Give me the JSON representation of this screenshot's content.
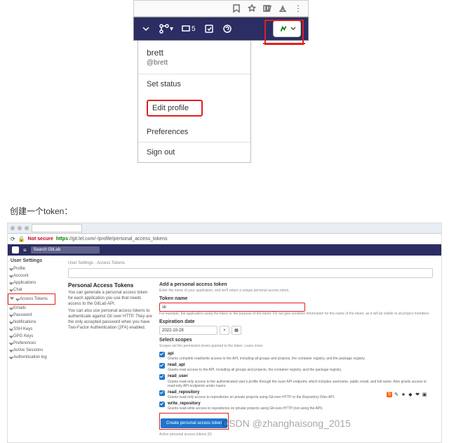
{
  "top": {
    "user_name": "brett",
    "user_handle": "@brett",
    "menu": {
      "set_status": "Set status",
      "edit_profile": "Edit profile",
      "preferences": "Preferences",
      "sign_out": "Sign out"
    },
    "issues_badge": "5"
  },
  "caption": "创建一个token：",
  "browser": {
    "not_secure": "Not secure",
    "url_prefix": "https",
    "url_rest": "://git.lel.com/-/profile/personal_access_tokens"
  },
  "gitlab": {
    "search_ph": "Search GitLab",
    "breadcrumb": "User Settings · Access Tokens",
    "sidebar": {
      "heading": "User Settings",
      "items": [
        "Profile",
        "Account",
        "Applications",
        "Chat",
        "Access Tokens",
        "Emails",
        "Password",
        "Notifications",
        "SSH Keys",
        "GPG Keys",
        "Preferences",
        "Active Sessions",
        "Authentication log"
      ]
    },
    "left": {
      "title": "Personal Access Tokens",
      "p1": "You can generate a personal access token for each application you use that needs access to the GitLab API.",
      "p2": "You can also use personal access tokens to authenticate against Git over HTTP. They are the only accepted password when you have Two-Factor Authentication (2FA) enabled."
    },
    "form": {
      "h": "Add a personal access token",
      "sub": "Enter the name of your application, and we'll return a unique personal access token.",
      "name_label": "Token name",
      "name_value": "sk",
      "name_hint": "For example, the application using the token or the purpose of the token. Do not give sensitive information for the name of the token, as it will be visible to all project members.",
      "exp_label": "Expiration date",
      "exp_value": "2022-10-28",
      "scopes_label": "Select scopes",
      "scopes_hint": "Scopes set the permission levels granted to the token. Learn more.",
      "scopes": [
        {
          "n": "api",
          "d": "Grants complete read/write access to the API, including all groups and projects, the container registry, and the package registry."
        },
        {
          "n": "read_api",
          "d": "Grants read access to the API, including all groups and projects, the container registry, and the package registry."
        },
        {
          "n": "read_user",
          "d": "Grants read-only access to the authenticated user's profile through the /user API endpoint, which includes username, public email, and full name. Also grants access to read-only API endpoints under /users."
        },
        {
          "n": "read_repository",
          "d": "Grants read-only access to repositories on private projects using Git-over-HTTP or the Repository Files API."
        },
        {
          "n": "write_repository",
          "d": "Grants read-write access to repositories on private projects using Git-over-HTTP (not using the API)."
        }
      ],
      "button": "Create personal access token",
      "footer": "Active personal access tokens (0)"
    }
  },
  "watermark": "CSDN @zhanghaisong_2015"
}
